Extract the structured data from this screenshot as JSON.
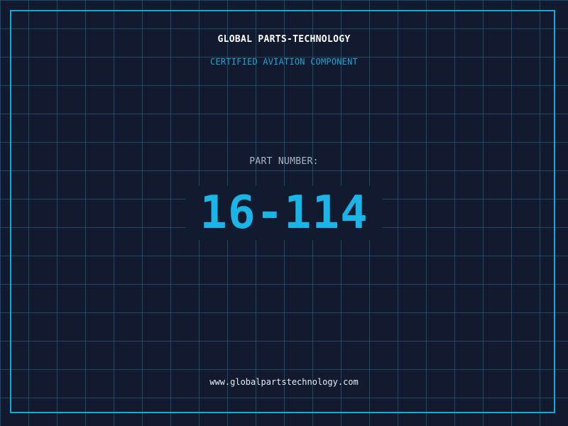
{
  "header": {
    "title": "GLOBAL PARTS-TECHNOLOGY",
    "subtitle": "CERTIFIED AVIATION COMPONENT"
  },
  "part": {
    "label": "PART NUMBER:",
    "number": "16-114"
  },
  "footer": {
    "url": "www.globalpartstechnology.com"
  },
  "colors": {
    "background": "#111a2e",
    "grid": "#288caa",
    "accent": "#1aa6d6",
    "part_number": "#19b5e6",
    "title": "#ffffff",
    "label": "#a9b6c8"
  }
}
